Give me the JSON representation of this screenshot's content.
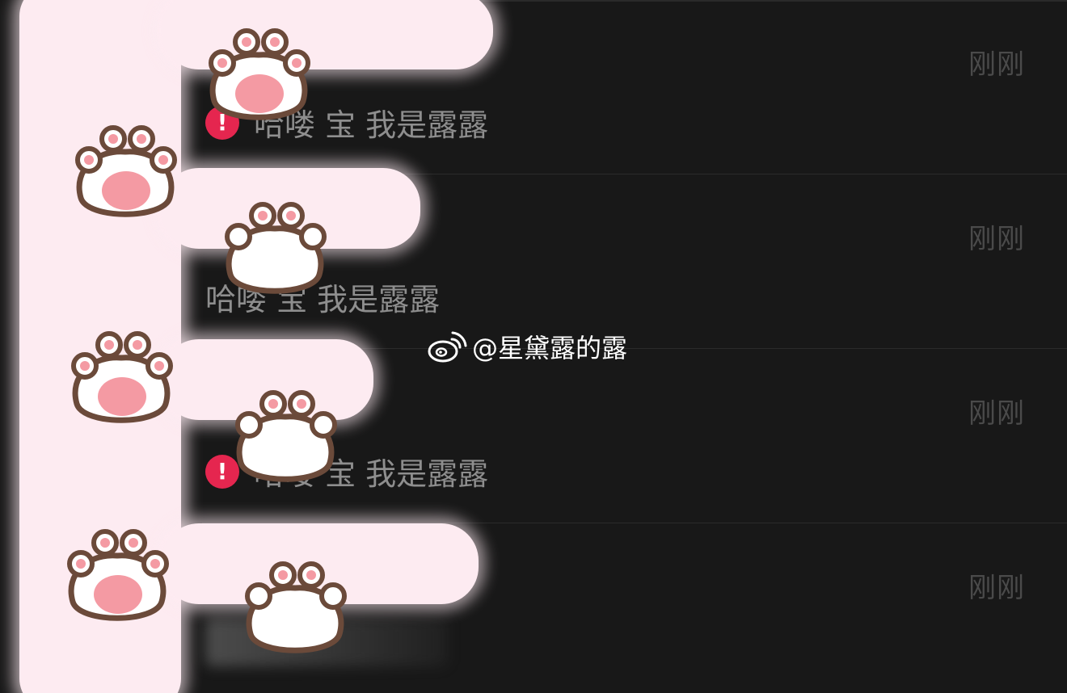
{
  "conversations": [
    {
      "time": "刚刚",
      "message": "哈喽 宝 我是露露",
      "failed": true
    },
    {
      "time": "刚刚",
      "message": "哈喽 宝 我是露露",
      "failed": false
    },
    {
      "time": "刚刚",
      "message": "哈喽 宝 我是露露",
      "failed": true
    },
    {
      "time": "刚刚",
      "message": "",
      "failed": false
    }
  ],
  "watermark": {
    "handle": "@星黛露的露",
    "icon": "weibo-icon"
  },
  "colors": {
    "background": "#181818",
    "time_text": "#4a4a4a",
    "message_text": "#8e8e8e",
    "error_badge": "#e5264f",
    "sticker_pink": "#fdebf1",
    "paw_pad": "#f49aa3",
    "paw_outline": "#6b4a3a"
  }
}
